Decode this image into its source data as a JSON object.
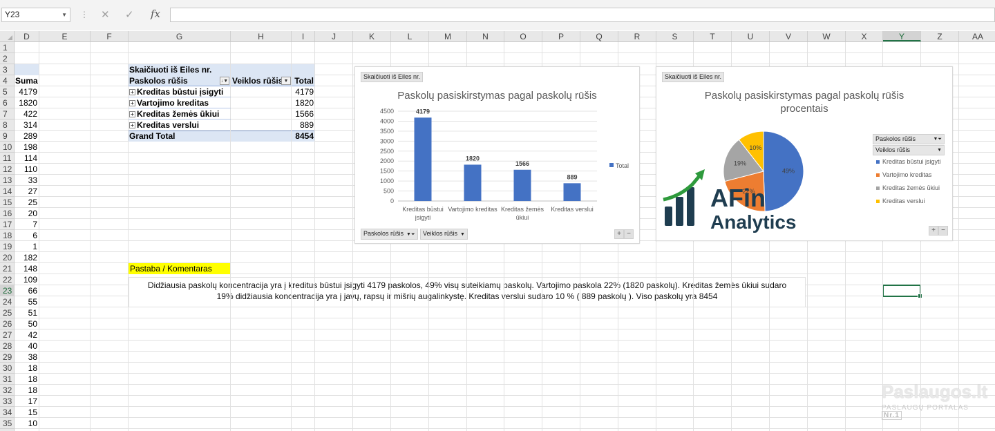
{
  "formula_bar": {
    "name_box": "Y23",
    "fx": "fx",
    "formula": ""
  },
  "columns": [
    {
      "label": "D",
      "w": 36
    },
    {
      "label": "E",
      "w": 74
    },
    {
      "label": "F",
      "w": 55
    },
    {
      "label": "G",
      "w": 148
    },
    {
      "label": "H",
      "w": 88
    },
    {
      "label": "I",
      "w": 34
    },
    {
      "label": "J",
      "w": 55
    },
    {
      "label": "K",
      "w": 55
    },
    {
      "label": "L",
      "w": 55
    },
    {
      "label": "M",
      "w": 55
    },
    {
      "label": "N",
      "w": 54
    },
    {
      "label": "O",
      "w": 55
    },
    {
      "label": "P",
      "w": 55
    },
    {
      "label": "Q",
      "w": 55
    },
    {
      "label": "R",
      "w": 55
    },
    {
      "label": "S",
      "w": 54
    },
    {
      "label": "T",
      "w": 55
    },
    {
      "label": "U",
      "w": 55
    },
    {
      "label": "V",
      "w": 55
    },
    {
      "label": "W",
      "w": 55
    },
    {
      "label": "X",
      "w": 54
    },
    {
      "label": "Y",
      "w": 55
    },
    {
      "label": "Z",
      "w": 55
    },
    {
      "label": "AA",
      "w": 55
    }
  ],
  "selected_column": "Y",
  "selected_row": 23,
  "rows": [
    1,
    2,
    3,
    4,
    5,
    6,
    7,
    8,
    9,
    10,
    11,
    12,
    13,
    14,
    15,
    16,
    17,
    18,
    19,
    20,
    21,
    22,
    23,
    24,
    25,
    26,
    27,
    28,
    29,
    30,
    31,
    32,
    33,
    34,
    35
  ],
  "col_d": {
    "header": "Suma",
    "values": [
      "4179",
      "1820",
      "422",
      "314",
      "289",
      "198",
      "114",
      "110",
      "33",
      "27",
      "25",
      "20",
      "7",
      "6",
      "1",
      "182",
      "148",
      "109",
      "66",
      "55",
      "51",
      "50",
      "42",
      "40",
      "38",
      "18",
      "18",
      "18",
      "17",
      "15",
      "10"
    ]
  },
  "pivot": {
    "filter_label": "Skaičiuoti iš Eiles nr.",
    "row_header": "Paskolos rūšis",
    "col_header": "Veiklos rūšis",
    "total_header": "Total",
    "rows": [
      {
        "label": "Kreditas būstui įsigyti",
        "value": "4179"
      },
      {
        "label": "Vartojimo kreditas",
        "value": "1820"
      },
      {
        "label": "Kreditas žemės ūkiui",
        "value": "1566"
      },
      {
        "label": "Kreditas verslui",
        "value": "889"
      }
    ],
    "grand_total_label": "Grand Total",
    "grand_total_value": "8454"
  },
  "note": {
    "label": "Pastaba / Komentaras",
    "text": "Didžiausia paskolų koncentracija yra į kreditus būstui įsigyti 4179 paskolos, 49% visų suteikiamų paskolų. Vartojimo paskola 22% (1820 paskolų). Kreditas žemės ūkiui sudaro 19% didžiausia koncentracija yra į javų, rapsų ir mišrių augalinkystę. Kreditas verslui sudaro 10 % ( 889 paskolų ). Viso paskolų yra 8454"
  },
  "chart_data": [
    {
      "type": "bar",
      "title": "Paskolų pasiskirstymas pagal paskolų rūšis",
      "filter_button": "Skaičiuoti iš Eiles nr.",
      "axis_buttons": [
        "Paskolos rūšis",
        "Veiklos rūšis"
      ],
      "categories": [
        [
          "Kreditas būstui",
          "įsigyti"
        ],
        [
          "Vartojimo kreditas"
        ],
        [
          "Kreditas žemės",
          "ūkiui"
        ],
        [
          "Kreditas verslui"
        ]
      ],
      "series": [
        {
          "name": "Total",
          "values": [
            4179,
            1820,
            1566,
            889
          ],
          "color": "#4472c4"
        }
      ],
      "data_labels": [
        "4179",
        "1820",
        "1566",
        "889"
      ],
      "yticks": [
        0,
        500,
        1000,
        1500,
        2000,
        2500,
        3000,
        3500,
        4000,
        4500
      ],
      "ylim": [
        0,
        4500
      ],
      "legend_position": "right",
      "grid": true
    },
    {
      "type": "pie",
      "title_lines": [
        "Paskolų pasiskirstymas pagal paskolų rūšis",
        "procentais"
      ],
      "filter_button": "Skaičiuoti iš Eiles nr.",
      "legend_buttons": [
        "Paskolos rūšis",
        "Veiklos rūšis"
      ],
      "labels": [
        "Kreditas būstui įsigyti",
        "Vartojimo kreditas",
        "Kreditas žemės ūkiui",
        "Kreditas verslui"
      ],
      "values": [
        4179,
        1820,
        1566,
        889
      ],
      "percent_labels": [
        "49%",
        "22%",
        "19%",
        "10%"
      ],
      "colors": [
        "#4472c4",
        "#ed7d31",
        "#a5a5a5",
        "#ffc000"
      ],
      "legend_position": "right"
    }
  ],
  "logo": {
    "line1": "AFin",
    "line2": "Analytics",
    "color": "#1f3d50",
    "arrow_color": "#2e9a3c"
  },
  "watermark": {
    "title": "Paslaugos.lt",
    "subtitle": "PASLAUGŲ PORTALAS",
    "badge": "Nr.1"
  },
  "buttons": {
    "plus": "+",
    "minus": "−"
  }
}
